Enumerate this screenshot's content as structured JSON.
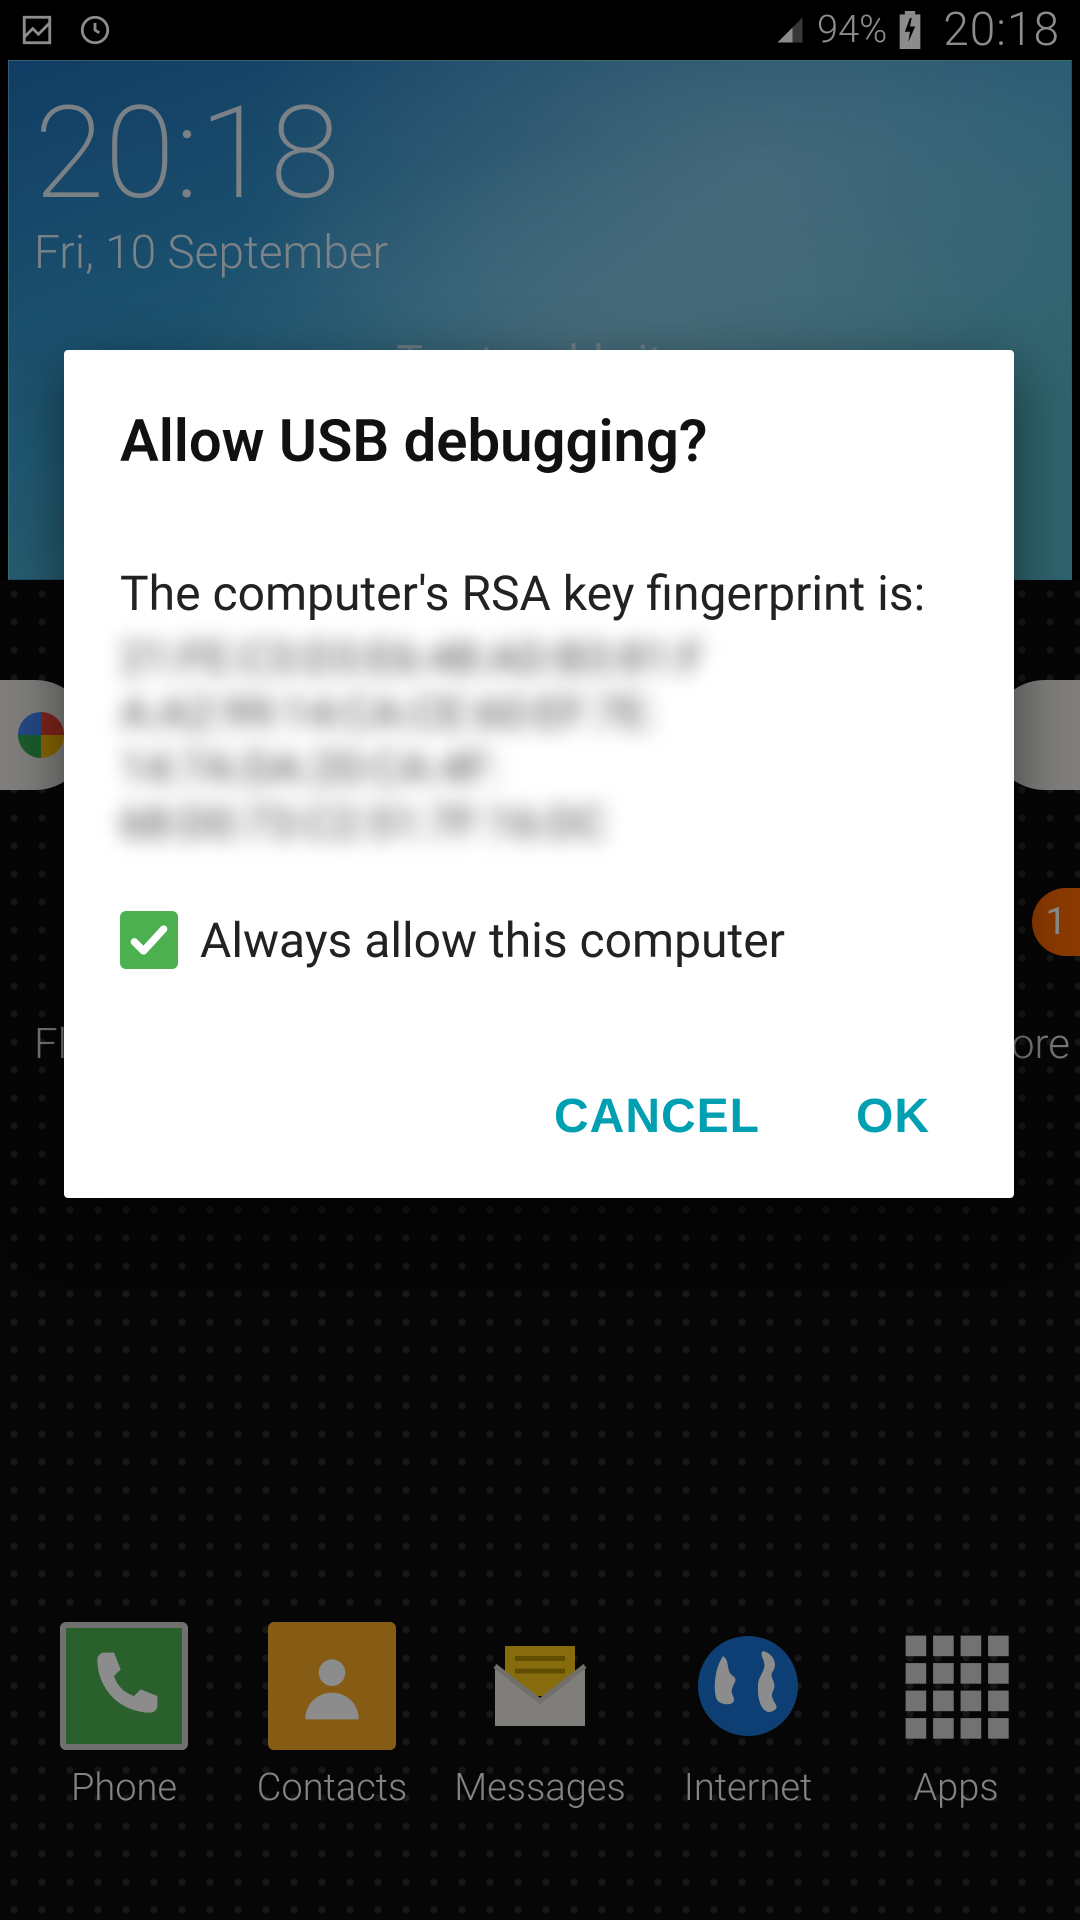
{
  "status_bar": {
    "battery_percent": "94%",
    "clock": "20:18"
  },
  "widget": {
    "time": "20:18",
    "date": "Fri, 10 September",
    "weather_prompt": "Tap to add city"
  },
  "badge": {
    "count": "1"
  },
  "fragments": {
    "left": "Fla",
    "right": "ore"
  },
  "dock": {
    "phone": "Phone",
    "contacts": "Contacts",
    "messages": "Messages",
    "internet": "Internet",
    "apps": "Apps"
  },
  "dialog": {
    "title": "Allow USB debugging?",
    "message": "The computer's RSA key fingerprint is:",
    "fingerprint_blurred": "21:FE:C3:D3:E6:48:AD:B3:81:F\nA:A2:99:14:CA:CE:60:EF:7E:\n14:7A:DA:20:CA:4F:\n68:D0:73:C2:51:7F:16:DC",
    "checkbox_label": "Always allow this computer",
    "checkbox_checked": true,
    "cancel": "CANCEL",
    "ok": "OK"
  }
}
